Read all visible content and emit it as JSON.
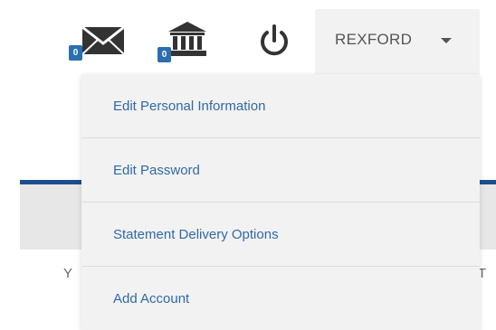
{
  "header": {
    "mail": {
      "icon": "mail-icon",
      "badge": "0"
    },
    "bank": {
      "icon": "bank-icon",
      "badge": "0"
    },
    "power": {
      "icon": "power-icon"
    },
    "user_menu": {
      "name": "REXFORD",
      "caret_icon": "caret-down-icon"
    }
  },
  "dropdown": {
    "items": [
      {
        "label": "Edit Personal Information"
      },
      {
        "label": "Edit Password"
      },
      {
        "label": "Statement Delivery Options"
      },
      {
        "label": "Add Account"
      }
    ]
  },
  "background": {
    "left_fragment": "Y",
    "right_fragment": "T"
  },
  "colors": {
    "link": "#2f6aa7",
    "badge": "#2a6fb0",
    "brand_bar": "#1d4e8f",
    "icon": "#333333"
  }
}
